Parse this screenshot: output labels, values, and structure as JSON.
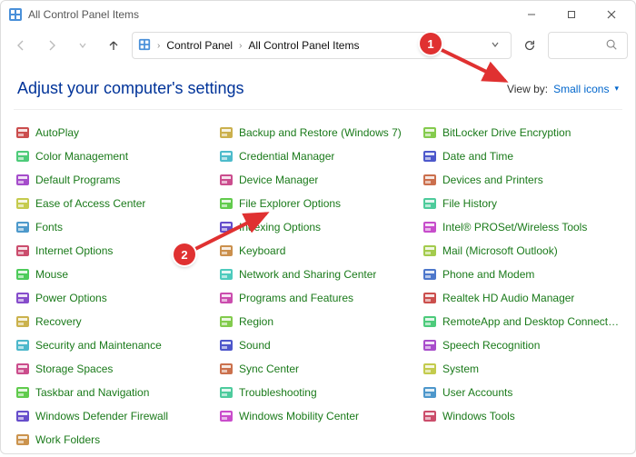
{
  "window": {
    "title": "All Control Panel Items"
  },
  "breadcrumb": {
    "root_icon": "control-panel-icon",
    "items": [
      "Control Panel",
      "All Control Panel Items"
    ]
  },
  "heading": "Adjust your computer's settings",
  "view_by": {
    "label": "View by:",
    "value": "Small icons"
  },
  "items": [
    "AutoPlay",
    "Backup and Restore (Windows 7)",
    "BitLocker Drive Encryption",
    "Color Management",
    "Credential Manager",
    "Date and Time",
    "Default Programs",
    "Device Manager",
    "Devices and Printers",
    "Ease of Access Center",
    "File Explorer Options",
    "File History",
    "Fonts",
    "Indexing Options",
    "Intel® PROSet/Wireless Tools",
    "Internet Options",
    "Keyboard",
    "Mail (Microsoft Outlook)",
    "Mouse",
    "Network and Sharing Center",
    "Phone and Modem",
    "Power Options",
    "Programs and Features",
    "Realtek HD Audio Manager",
    "Recovery",
    "Region",
    "RemoteApp and Desktop Connectio...",
    "Security and Maintenance",
    "Sound",
    "Speech Recognition",
    "Storage Spaces",
    "Sync Center",
    "System",
    "Taskbar and Navigation",
    "Troubleshooting",
    "User Accounts",
    "Windows Defender Firewall",
    "Windows Mobility Center",
    "Windows Tools",
    "Work Folders"
  ],
  "annotations": {
    "callout1": "1",
    "callout2": "2"
  }
}
